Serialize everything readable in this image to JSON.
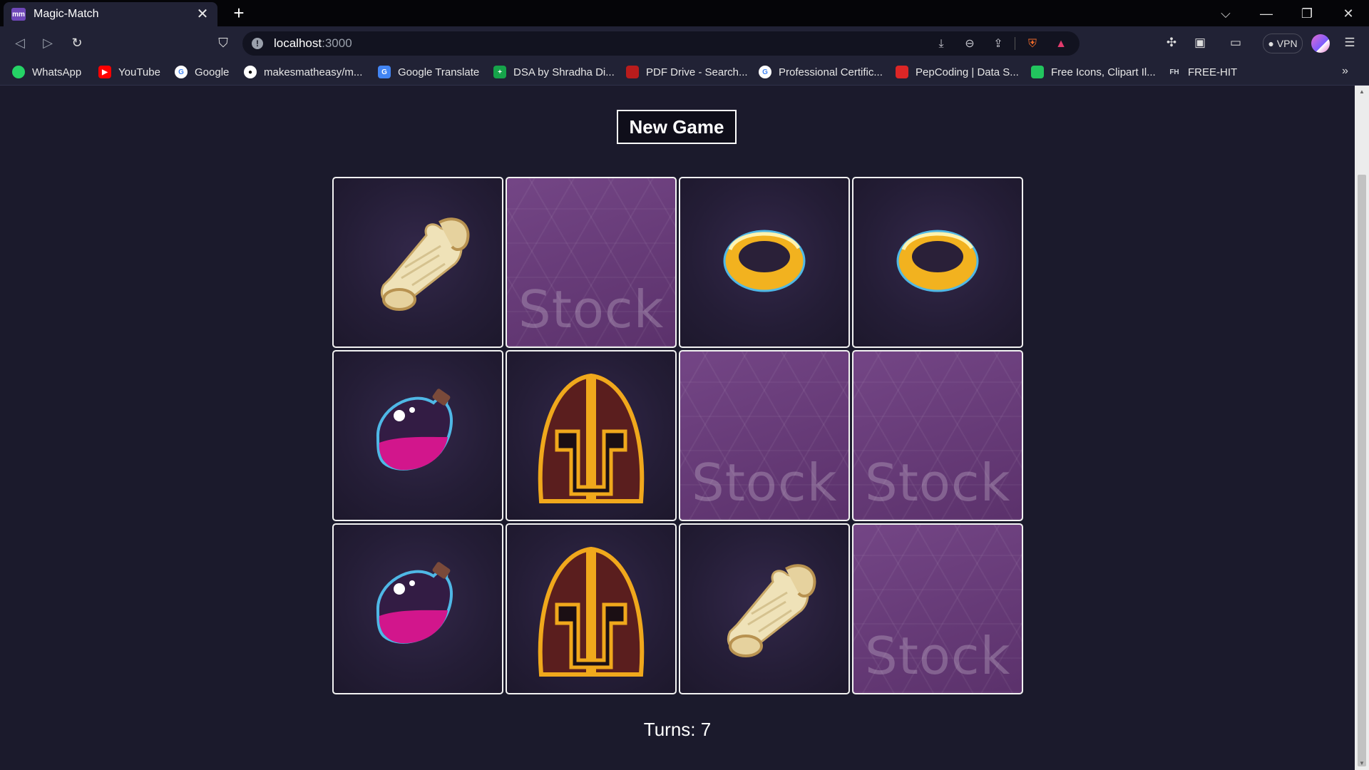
{
  "browser": {
    "tab_title": "Magic-Match",
    "tab_favicon_text": "mm",
    "url_host": "localhost",
    "url_port": ":3000",
    "vpn_label": "VPN"
  },
  "bookmarks": [
    {
      "label": "WhatsApp",
      "icon": "whatsapp-icon",
      "color": "#25d366"
    },
    {
      "label": "YouTube",
      "icon": "youtube-icon",
      "color": "#ff0000"
    },
    {
      "label": "Google",
      "icon": "google-icon",
      "color": "#ffffff"
    },
    {
      "label": "makesmatheasy/m...",
      "icon": "github-icon",
      "color": "#ffffff"
    },
    {
      "label": "Google Translate",
      "icon": "translate-icon",
      "color": "#4285f4"
    },
    {
      "label": "DSA by Shradha Di...",
      "icon": "plus-icon",
      "color": "#16a34a"
    },
    {
      "label": "PDF Drive - Search...",
      "icon": "pdf-icon",
      "color": "#b91c1c"
    },
    {
      "label": "Professional Certific...",
      "icon": "google-icon",
      "color": "#ffffff"
    },
    {
      "label": "PepCoding | Data S...",
      "icon": "pepcoding-icon",
      "color": "#dc2626"
    },
    {
      "label": "Free Icons, Clipart Il...",
      "icon": "icons-icon",
      "color": "#22c55e"
    },
    {
      "label": "FREE-HIT",
      "icon": "fh-icon",
      "color": "#d1d5db"
    }
  ],
  "game": {
    "new_game_label": "New Game",
    "turns_text": "Turns: 7",
    "watermark": "Stock",
    "cards": [
      {
        "state": "face-up",
        "symbol": "scroll"
      },
      {
        "state": "face-down",
        "symbol": ""
      },
      {
        "state": "face-up",
        "symbol": "ring"
      },
      {
        "state": "face-up",
        "symbol": "ring"
      },
      {
        "state": "face-up",
        "symbol": "potion"
      },
      {
        "state": "face-up",
        "symbol": "helmet"
      },
      {
        "state": "face-down",
        "symbol": ""
      },
      {
        "state": "face-down",
        "symbol": ""
      },
      {
        "state": "face-up",
        "symbol": "potion"
      },
      {
        "state": "face-up",
        "symbol": "helmet"
      },
      {
        "state": "face-up",
        "symbol": "scroll"
      },
      {
        "state": "face-down",
        "symbol": ""
      }
    ]
  },
  "colors": {
    "page_bg": "#1b1a2c",
    "card_border": "#f2f2f2",
    "card_back": "#6b3a7e"
  }
}
